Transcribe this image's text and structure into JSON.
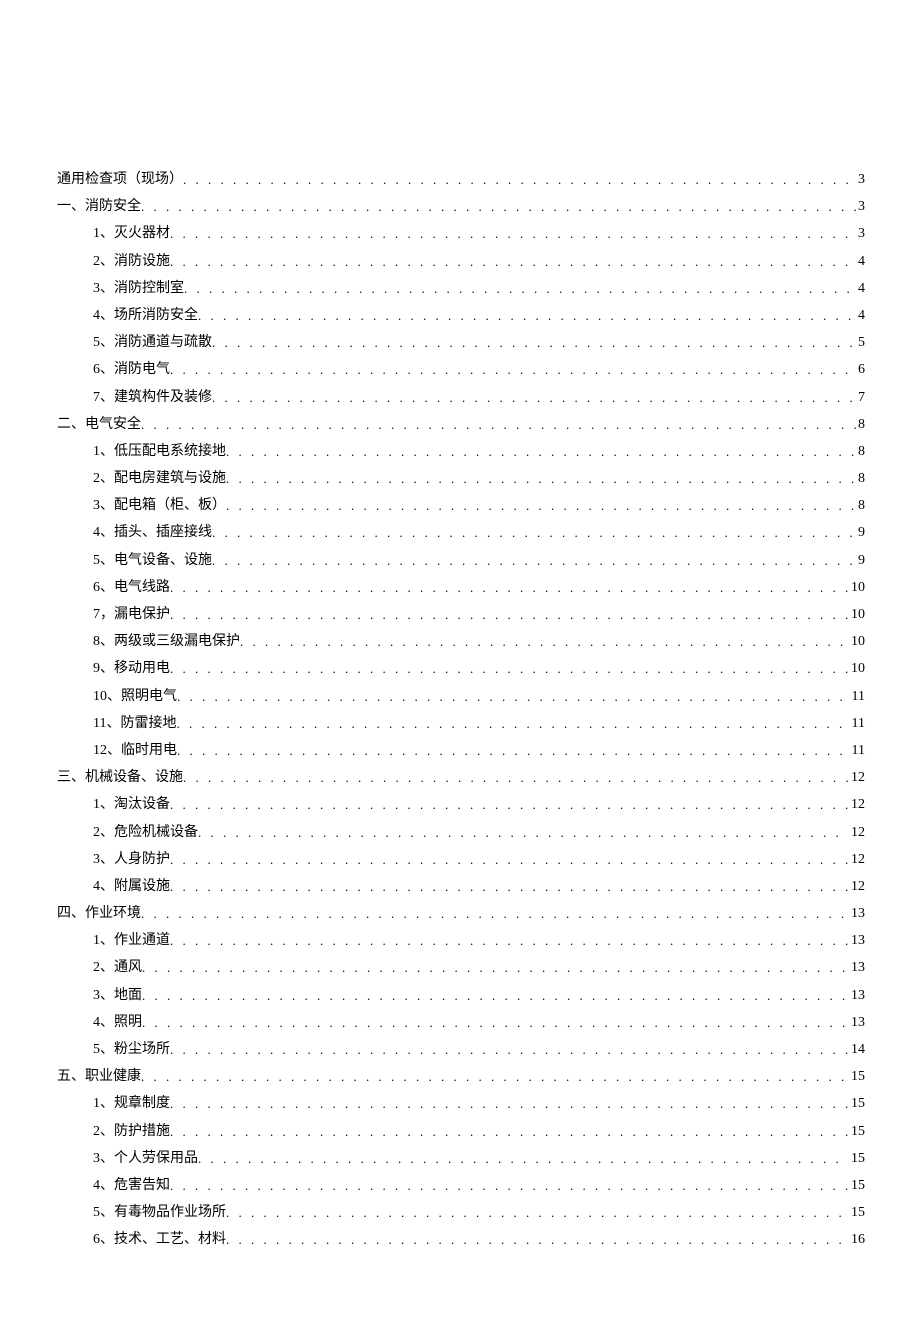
{
  "entries": [
    {
      "level": 1,
      "title": "通用检查项（现场）",
      "page": "3"
    },
    {
      "level": 1,
      "title": "一、消防安全",
      "page": "3"
    },
    {
      "level": 2,
      "title": "1、灭火器材",
      "page": "3"
    },
    {
      "level": 2,
      "title": "2、消防设施",
      "page": "4"
    },
    {
      "level": 2,
      "title": "3、消防控制室",
      "page": "4"
    },
    {
      "level": 2,
      "title": "4、场所消防安全",
      "page": "4"
    },
    {
      "level": 2,
      "title": "5、消防通道与疏散",
      "page": "5"
    },
    {
      "level": 2,
      "title": "6、消防电气",
      "page": "6"
    },
    {
      "level": 2,
      "title": "7、建筑构件及装修",
      "page": "7"
    },
    {
      "level": 1,
      "title": "二、电气安全",
      "page": "8"
    },
    {
      "level": 2,
      "title": "1、低压配电系统接地",
      "page": "8"
    },
    {
      "level": 2,
      "title": "2、配电房建筑与设施",
      "page": "8"
    },
    {
      "level": 2,
      "title": "3、配电箱（柜、板）",
      "page": "8"
    },
    {
      "level": 2,
      "title": "4、插头、插座接线",
      "page": "9"
    },
    {
      "level": 2,
      "title": "5、电气设备、设施",
      "page": "9"
    },
    {
      "level": 2,
      "title": "6、电气线路",
      "page": "10"
    },
    {
      "level": 2,
      "title": "7，漏电保护",
      "page": "10"
    },
    {
      "level": 2,
      "title": "8、两级或三级漏电保护",
      "page": "10"
    },
    {
      "level": 2,
      "title": "9、移动用电",
      "page": "10"
    },
    {
      "level": 2,
      "title": "10、照明电气",
      "page": "11"
    },
    {
      "level": 2,
      "title": "11、防雷接地",
      "page": "11"
    },
    {
      "level": 2,
      "title": "12、临时用电",
      "page": "11"
    },
    {
      "level": 1,
      "title": "三、机械设备、设施",
      "page": "12"
    },
    {
      "level": 2,
      "title": "1、淘汰设备",
      "page": "12"
    },
    {
      "level": 2,
      "title": "2、危险机械设备",
      "page": "12"
    },
    {
      "level": 2,
      "title": "3、人身防护",
      "page": "12"
    },
    {
      "level": 2,
      "title": "4、附属设施",
      "page": "12"
    },
    {
      "level": 1,
      "title": "四、作业环境",
      "page": "13"
    },
    {
      "level": 2,
      "title": "1、作业通道",
      "page": "13"
    },
    {
      "level": 2,
      "title": "2、通风",
      "page": "13"
    },
    {
      "level": 2,
      "title": "3、地面",
      "page": "13"
    },
    {
      "level": 2,
      "title": "4、照明",
      "page": "13"
    },
    {
      "level": 2,
      "title": "5、粉尘场所",
      "page": "14"
    },
    {
      "level": 1,
      "title": "五、职业健康",
      "page": "15"
    },
    {
      "level": 2,
      "title": "1、规章制度",
      "page": "15"
    },
    {
      "level": 2,
      "title": "2、防护措施",
      "page": "15"
    },
    {
      "level": 2,
      "title": "3、个人劳保用品",
      "page": "15"
    },
    {
      "level": 2,
      "title": "4、危害告知",
      "page": "15"
    },
    {
      "level": 2,
      "title": "5、有毒物品作业场所",
      "page": "15"
    },
    {
      "level": 2,
      "title": "6、技术、工艺、材料",
      "page": "16"
    }
  ]
}
